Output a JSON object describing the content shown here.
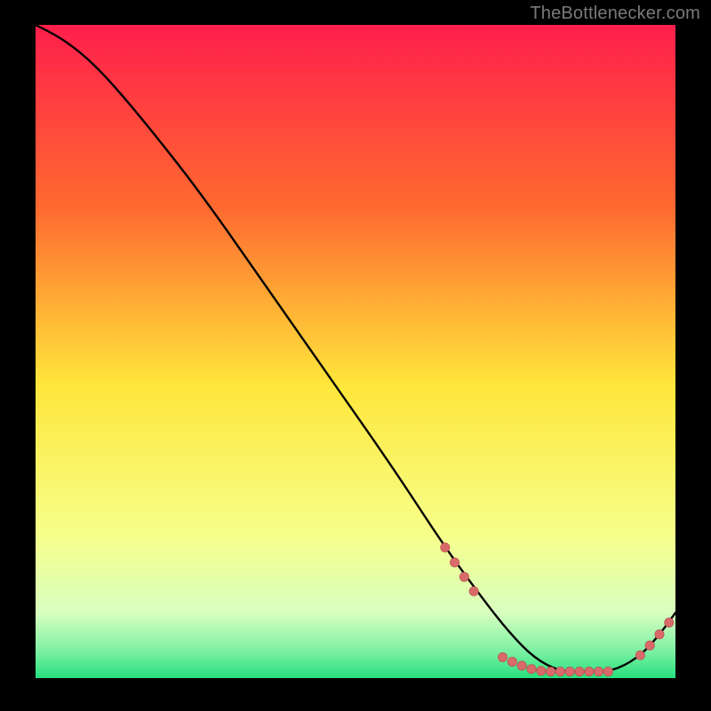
{
  "watermark": "TheBottlenecker.com",
  "colors": {
    "bg_black": "#000000",
    "grad_top": "#ff1f4b",
    "grad_mid1": "#ff8a2a",
    "grad_mid2": "#ffe63a",
    "grad_low1": "#f6ff8a",
    "grad_low2": "#b8ffb2",
    "grad_bot": "#26e07e",
    "curve": "#000000",
    "marker": "#d86a6a",
    "marker_stroke": "#b34d4d"
  },
  "chart_data": {
    "type": "line",
    "title": "",
    "xlabel": "",
    "ylabel": "",
    "xlim": [
      0,
      100
    ],
    "ylim": [
      0,
      100
    ],
    "series": [
      {
        "name": "bottleneck-curve",
        "x": [
          0,
          4,
          8,
          12,
          18,
          26,
          36,
          46,
          56,
          64,
          70,
          74,
          78,
          82,
          86,
          90,
          94,
          97,
          100
        ],
        "y": [
          100,
          98,
          95,
          91,
          84,
          74,
          60,
          46,
          32,
          20,
          12,
          7,
          3,
          1,
          1,
          1,
          3,
          6,
          10
        ]
      }
    ],
    "markers": {
      "name": "highlight-points",
      "x": [
        64.0,
        65.5,
        67.0,
        68.5,
        73.0,
        74.5,
        76.0,
        77.5,
        79.0,
        80.5,
        82.0,
        83.5,
        85.0,
        86.5,
        88.0,
        89.5,
        94.5,
        96.0,
        97.5,
        99.0
      ],
      "y": [
        20.0,
        17.7,
        15.5,
        13.3,
        3.2,
        2.5,
        1.9,
        1.4,
        1.1,
        1.0,
        1.0,
        1.0,
        1.0,
        1.0,
        1.0,
        1.0,
        3.5,
        5.0,
        6.7,
        8.5
      ]
    }
  }
}
